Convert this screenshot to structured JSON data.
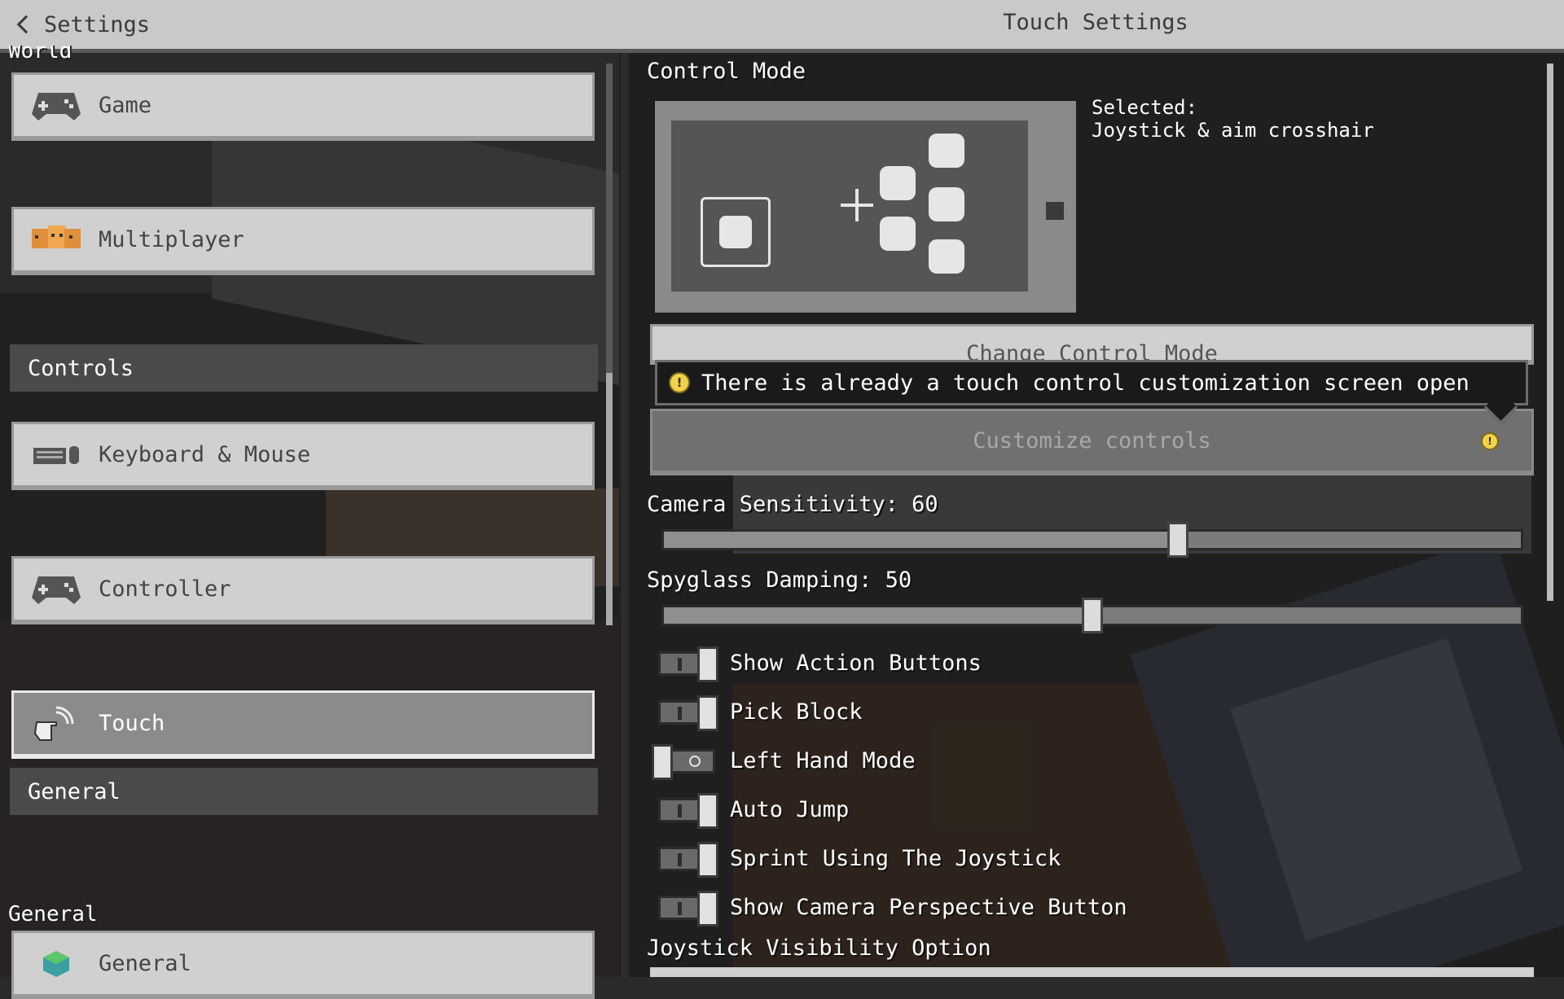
{
  "topbar": {
    "back_label": "Settings",
    "title": "Touch Settings"
  },
  "left": {
    "sections": {
      "world": "World",
      "general": "General"
    },
    "nav": {
      "game": "Game",
      "multiplayer": "Multiplayer",
      "keyboard_mouse": "Keyboard & Mouse",
      "controller": "Controller",
      "touch": "Touch",
      "general": "General"
    },
    "category_bars": {
      "controls": "Controls",
      "general": "General"
    }
  },
  "right": {
    "control_mode_label": "Control Mode",
    "selected_label": "Selected:",
    "selected_value": "Joystick & aim crosshair",
    "change_control_mode": "Change Control Mode",
    "tooltip_text": "There is already a touch control customization screen open",
    "customize_controls": "Customize controls",
    "camera_sensitivity_label": "Camera Sensitivity: 60",
    "camera_sensitivity_value": 60,
    "spyglass_damping_label": "Spyglass Damping: 50",
    "spyglass_damping_value": 50,
    "toggles": [
      {
        "label": "Show Action Buttons",
        "on": true
      },
      {
        "label": "Pick Block",
        "on": true
      },
      {
        "label": "Left Hand Mode",
        "on": false
      },
      {
        "label": "Auto Jump",
        "on": true
      },
      {
        "label": "Sprint Using The Joystick",
        "on": true
      },
      {
        "label": "Show Camera Perspective Button",
        "on": true
      }
    ],
    "joystick_visibility_label": "Joystick Visibility Option"
  },
  "icons": {
    "back": "chevron-left-icon",
    "game": "gamepad-icon",
    "multiplayer": "players-icon",
    "keyboard": "keyboard-mouse-icon",
    "controller": "gamepad-icon",
    "touch": "touch-hand-icon",
    "general": "grass-block-icon",
    "warning": "warning-icon"
  },
  "colors": {
    "button_face": "#d0d0d0",
    "active_button": "#8b8b8b",
    "category_bar": "#4a4a4a",
    "warning": "#f2d24a"
  }
}
